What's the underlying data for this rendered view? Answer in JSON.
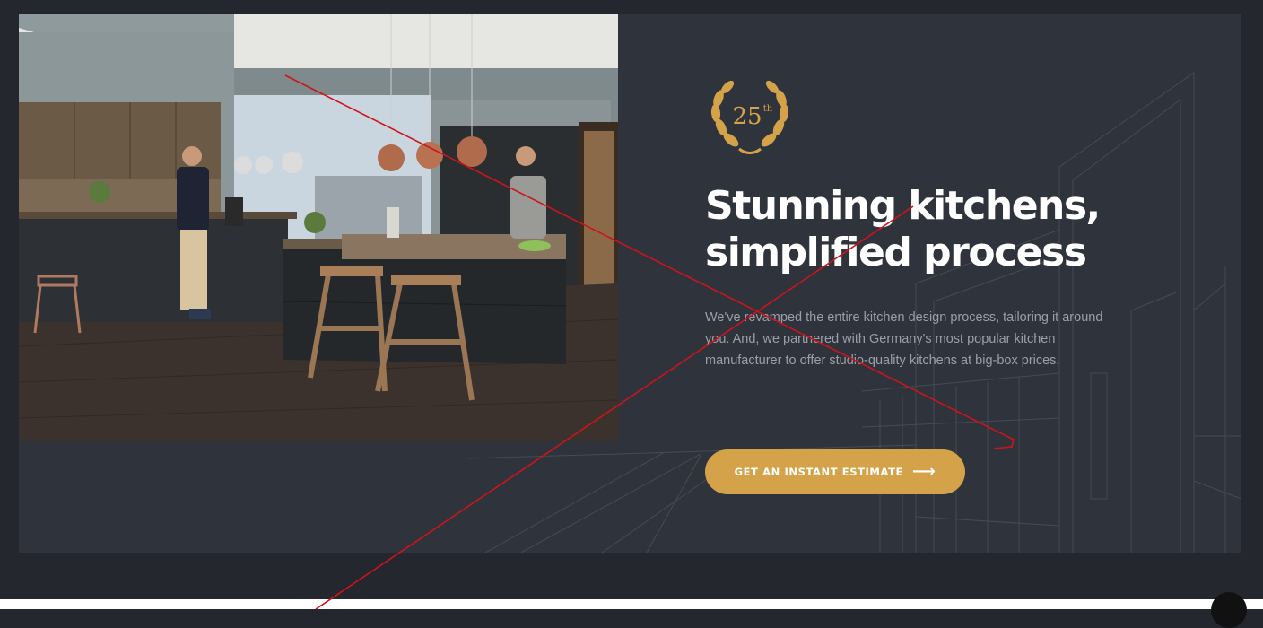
{
  "hero": {
    "badge": {
      "number": "25",
      "suffix": "th"
    },
    "headline_line1": "Stunning kitchens,",
    "headline_line2": "simplified process",
    "description": "We've revamped the entire kitchen design process, tailoring it around you. And, we partnered with Germany's most popular kitchen manufacturer to offer studio-quality kitchens at big-box prices.",
    "cta_label": "GET AN INSTANT ESTIMATE",
    "cta_icon": "arrow-right-icon"
  },
  "colors": {
    "page_bg": "#24272d",
    "hero_bg": "#2f333b",
    "accent": "#d4a349",
    "headline": "#ffffff",
    "body_text": "#9aa0a8"
  }
}
